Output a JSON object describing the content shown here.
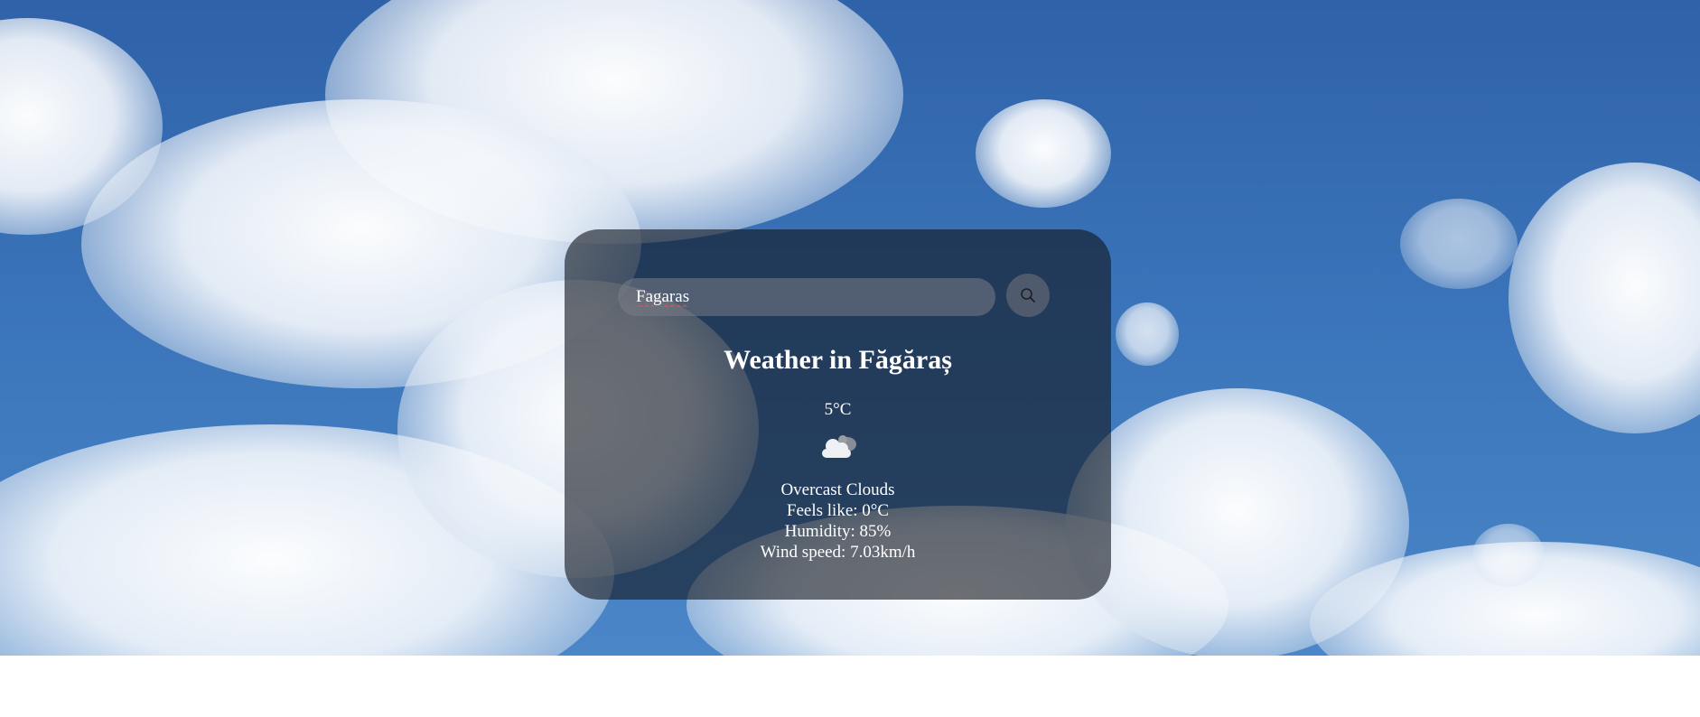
{
  "search": {
    "value": "Fagaras",
    "icon": "search-icon"
  },
  "weather": {
    "title": "Weather in Făgăraș",
    "temperature": "5°C",
    "icon": "overcast-clouds-icon",
    "description": "Overcast Clouds",
    "feels_like": "Feels like: 0°C",
    "humidity": "Humidity: 85%",
    "wind_speed": "Wind speed: 7.03km/h"
  },
  "colors": {
    "sky": "#3a73b9",
    "card_background": "rgba(20,24,32,0.62)",
    "text": "#ffffff"
  }
}
